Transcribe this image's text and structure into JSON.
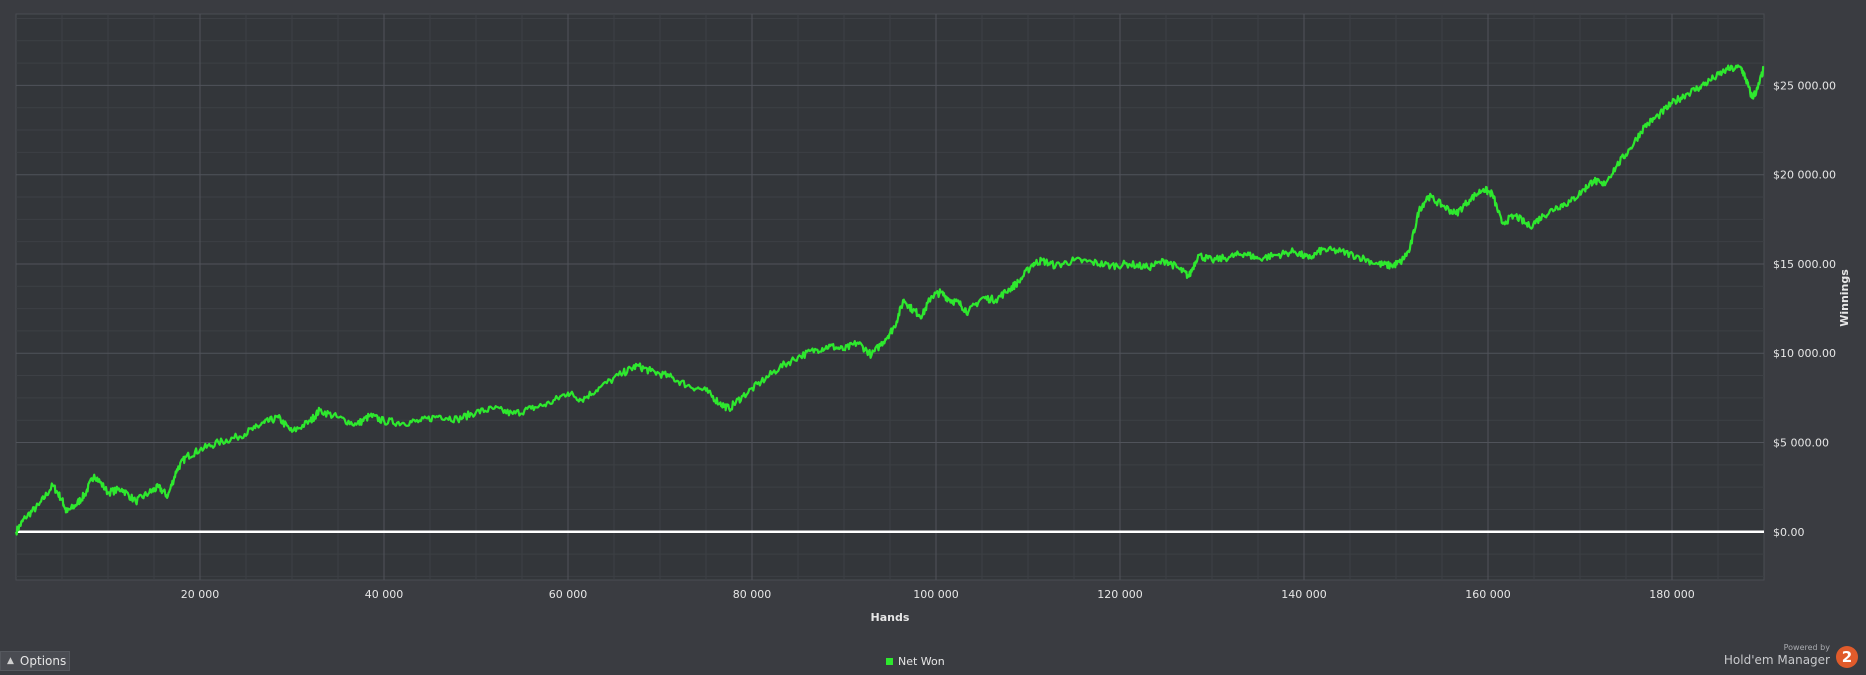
{
  "chart_data": {
    "type": "line",
    "title": "",
    "xlabel": "Hands",
    "ylabel": "Winnings",
    "xlim": [
      0,
      190000
    ],
    "ylim": [
      -2700,
      29000
    ],
    "x_ticks": [
      20000,
      40000,
      60000,
      80000,
      100000,
      120000,
      140000,
      160000,
      180000
    ],
    "x_tick_labels": [
      "20 000",
      "40 000",
      "60 000",
      "80 000",
      "100 000",
      "120 000",
      "140 000",
      "160 000",
      "180 000"
    ],
    "y_ticks": [
      0,
      5000,
      10000,
      15000,
      20000,
      25000
    ],
    "y_tick_labels": [
      "$0.00",
      "$5 000.00",
      "$10 000.00",
      "$15 000.00",
      "$20 000.00",
      "$25 000.00"
    ],
    "grid": true,
    "legend_position": "bottom",
    "series": [
      {
        "name": "Net Won",
        "color": "#2ee82e",
        "x": [
          0,
          1000,
          2500,
          4000,
          5000,
          5500,
          6500,
          7500,
          8500,
          10000,
          11500,
          13000,
          14500,
          15500,
          16500,
          17500,
          18500,
          20000,
          22000,
          24000,
          26000,
          27000,
          28500,
          30000,
          32000,
          33000,
          35000,
          37000,
          38500,
          40000,
          42000,
          44000,
          46000,
          48000,
          50000,
          52000,
          54000,
          56000,
          58000,
          60000,
          61500,
          63500,
          66000,
          67500,
          69000,
          71000,
          73000,
          75000,
          76500,
          77500,
          79000,
          81000,
          83000,
          85000,
          87000,
          88500,
          90000,
          91500,
          93000,
          94500,
          95500,
          96500,
          97500,
          98500,
          99500,
          100500,
          101500,
          102500,
          103500,
          105000,
          106500,
          108000,
          109000,
          110500,
          111500,
          113000,
          115000,
          117000,
          119000,
          121000,
          123000,
          125000,
          126500,
          127500,
          128500,
          130000,
          132000,
          133500,
          135000,
          137000,
          139000,
          140500,
          142000,
          144000,
          146000,
          148000,
          149500,
          150500,
          151500,
          152500,
          153500,
          155000,
          156500,
          158000,
          159500,
          160500,
          161500,
          163000,
          164500,
          166000,
          167500,
          169000,
          170500,
          171500,
          172500,
          174000,
          175500,
          177000,
          178500,
          180000,
          181500,
          183000,
          184500,
          186000,
          187500,
          188000,
          188700,
          189300,
          190000
        ],
        "y": [
          0,
          800,
          1500,
          2600,
          1800,
          1100,
          1500,
          2100,
          3200,
          2200,
          2400,
          1700,
          2200,
          2500,
          2000,
          3500,
          4200,
          4600,
          5000,
          5300,
          5800,
          6100,
          6400,
          5600,
          6200,
          6800,
          6400,
          6000,
          6500,
          6200,
          6100,
          6200,
          6500,
          6300,
          6700,
          6900,
          6600,
          6900,
          7200,
          7800,
          7400,
          8100,
          8900,
          9300,
          9000,
          8700,
          8200,
          7900,
          7200,
          6900,
          7600,
          8400,
          9200,
          9800,
          10200,
          10400,
          10200,
          10600,
          9900,
          10800,
          11500,
          13000,
          12400,
          12100,
          13200,
          13400,
          13000,
          12800,
          12300,
          13100,
          13000,
          13600,
          14000,
          15000,
          15200,
          14900,
          15200,
          15100,
          14900,
          15000,
          14800,
          15200,
          14700,
          14300,
          15500,
          15200,
          15400,
          15600,
          15300,
          15500,
          15700,
          15300,
          15800,
          15700,
          15400,
          15000,
          14900,
          15100,
          15800,
          18000,
          18800,
          18300,
          17800,
          18600,
          19200,
          18900,
          17300,
          17700,
          17100,
          17700,
          18200,
          18500,
          19200,
          19700,
          19400,
          20500,
          21500,
          22700,
          23300,
          24000,
          24500,
          24900,
          25400,
          25900,
          26000,
          25400,
          24300,
          24800,
          26000
        ]
      }
    ],
    "zero_line": true
  },
  "ui": {
    "options_label": "Options",
    "powered_by": "Powered by",
    "brand_name": "Hold'em Manager",
    "brand_logo": "2",
    "brand_color": "#e05b2b"
  }
}
